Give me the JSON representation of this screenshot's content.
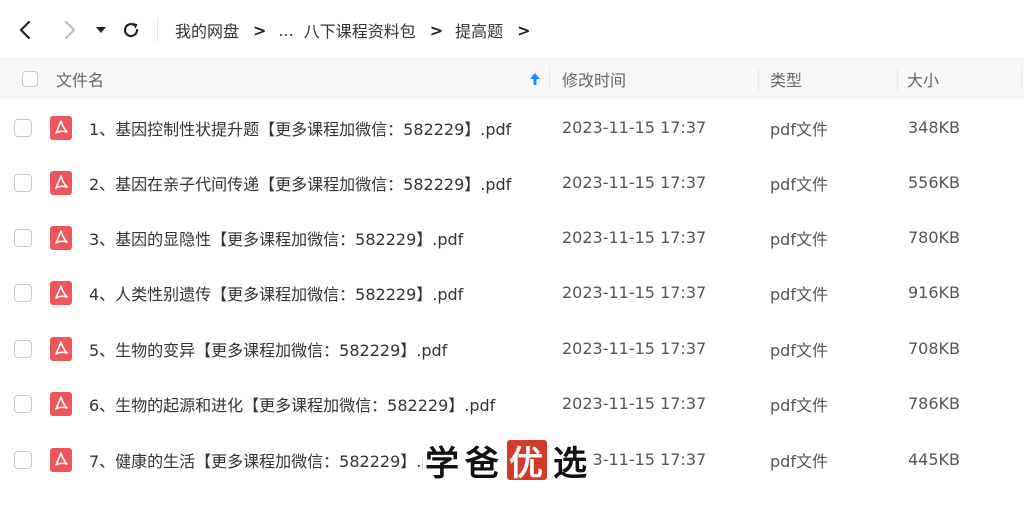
{
  "nav": {
    "back_icon": "chevron-left-icon",
    "forward_icon": "chevron-right-icon",
    "dropdown_icon": "caret-down-icon",
    "refresh_icon": "refresh-icon"
  },
  "breadcrumb": {
    "items": [
      "我的网盘",
      "...",
      "八下课程资料包",
      "提高题"
    ],
    "separator": ">"
  },
  "table": {
    "columns": {
      "name": "文件名",
      "modified": "修改时间",
      "type": "类型",
      "size": "大小"
    },
    "sort_icon": "sort-up-arrow-icon",
    "rows": [
      {
        "name": "1、基因控制性状提升题【更多课程加微信：582229】.pdf",
        "modified": "2023-11-15 17:37",
        "type": "pdf文件",
        "size": "348KB"
      },
      {
        "name": "2、基因在亲子代间传递【更多课程加微信：582229】.pdf",
        "modified": "2023-11-15 17:37",
        "type": "pdf文件",
        "size": "556KB"
      },
      {
        "name": "3、基因的显隐性【更多课程加微信：582229】.pdf",
        "modified": "2023-11-15 17:37",
        "type": "pdf文件",
        "size": "780KB"
      },
      {
        "name": "4、人类性别遗传【更多课程加微信：582229】.pdf",
        "modified": "2023-11-15 17:37",
        "type": "pdf文件",
        "size": "916KB"
      },
      {
        "name": "5、生物的变异【更多课程加微信：582229】.pdf",
        "modified": "2023-11-15 17:37",
        "type": "pdf文件",
        "size": "708KB"
      },
      {
        "name": "6、生物的起源和进化【更多课程加微信：582229】.pdf",
        "modified": "2023-11-15 17:37",
        "type": "pdf文件",
        "size": "786KB"
      },
      {
        "name": "7、健康的生活【更多课程加微信：582229】.pdf",
        "modified": "2023-11-15 17:37",
        "type": "pdf文件",
        "size": "445KB"
      }
    ]
  },
  "watermark": {
    "chars": [
      "学",
      "爸",
      "优",
      "选"
    ],
    "seal_color": "#d33a2c"
  },
  "colors": {
    "pdf_icon": "#f0555a",
    "sort_arrow": "#1a8cff",
    "header_bg": "#f7f7f8"
  }
}
